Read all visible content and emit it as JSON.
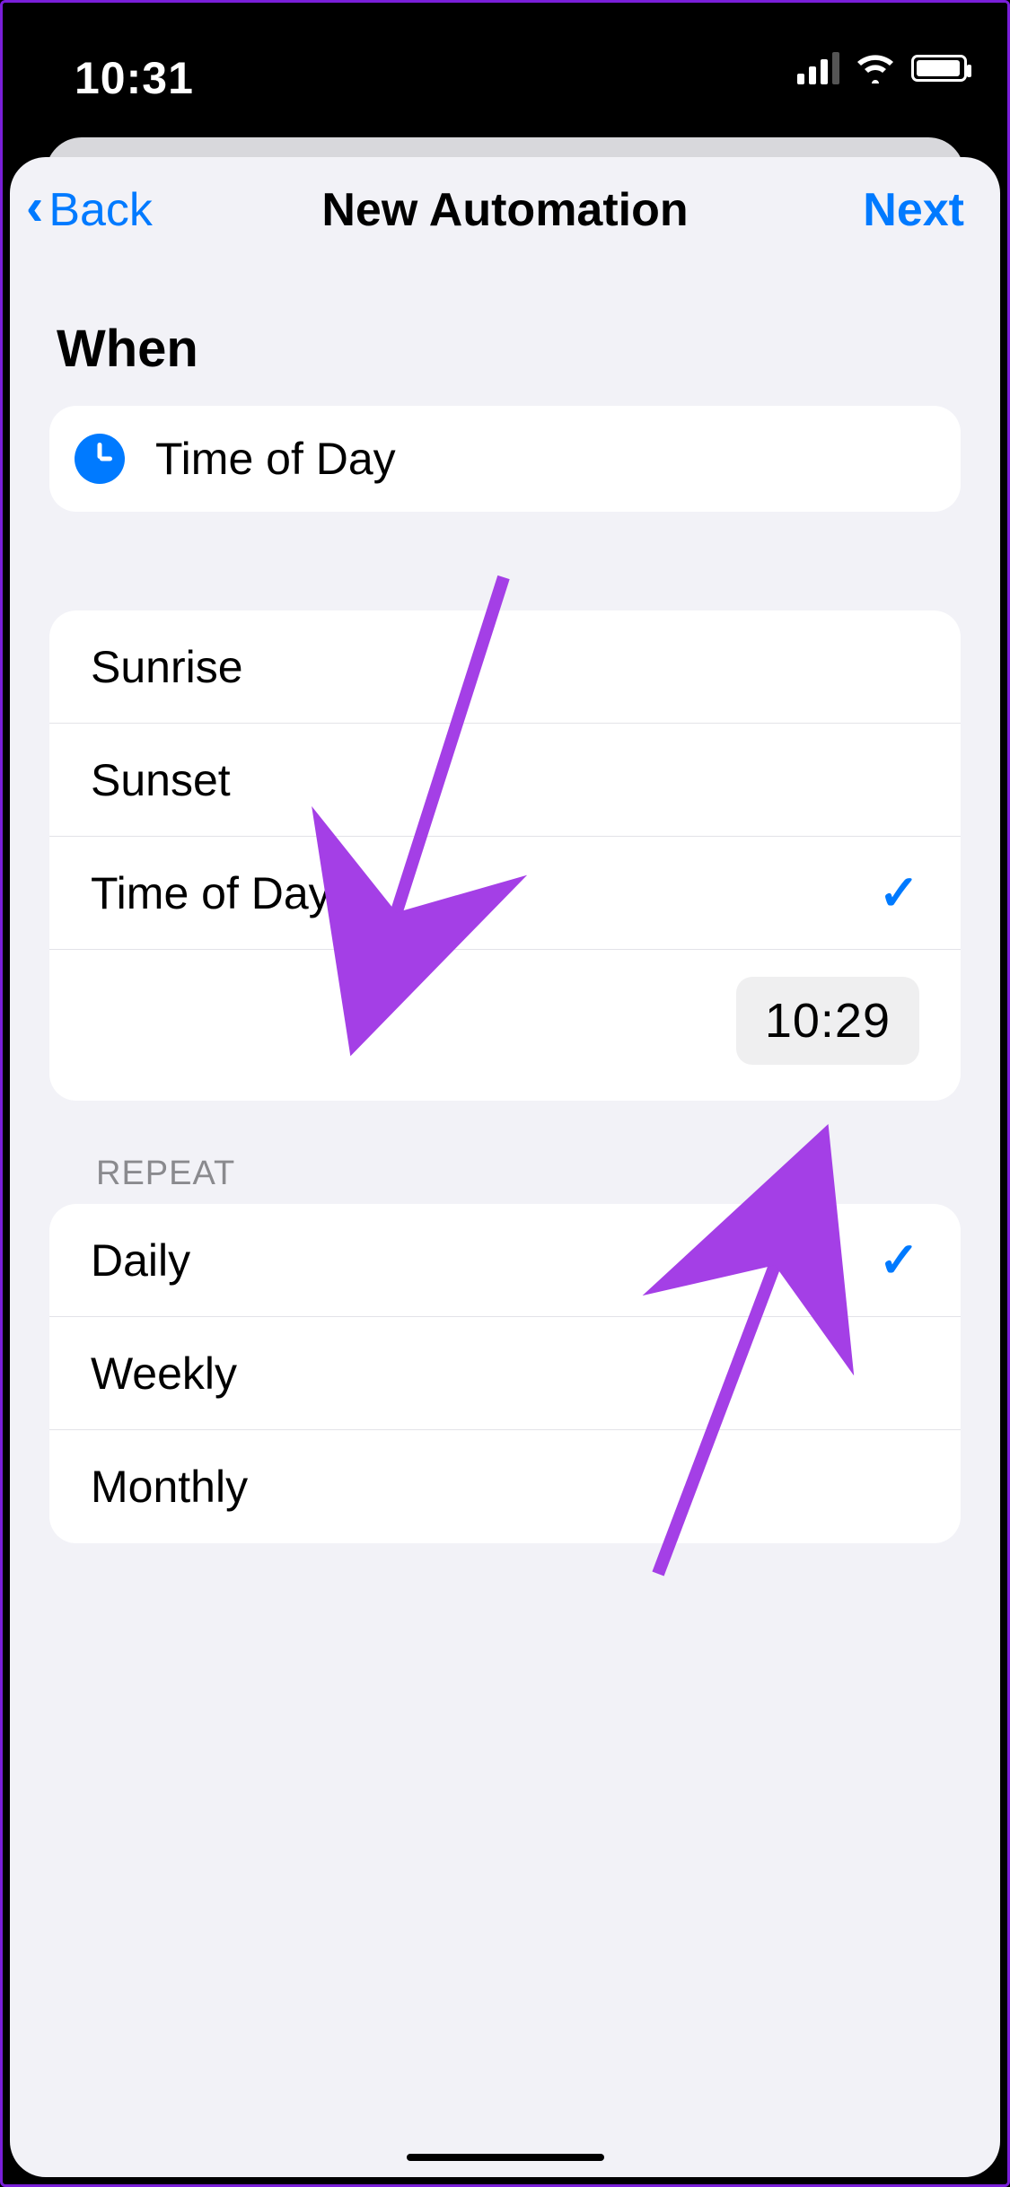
{
  "statusbar": {
    "time": "10:31"
  },
  "nav": {
    "back": "Back",
    "title": "New Automation",
    "next": "Next"
  },
  "section": {
    "when": "When"
  },
  "headerCard": {
    "label": "Time of Day"
  },
  "timeOptions": {
    "items": [
      {
        "label": "Sunrise",
        "checked": false
      },
      {
        "label": "Sunset",
        "checked": false
      },
      {
        "label": "Time of Day",
        "checked": true
      }
    ],
    "pickedTime": "10:29"
  },
  "repeat": {
    "label": "REPEAT",
    "items": [
      {
        "label": "Daily",
        "checked": true
      },
      {
        "label": "Weekly",
        "checked": false
      },
      {
        "label": "Monthly",
        "checked": false
      }
    ]
  }
}
